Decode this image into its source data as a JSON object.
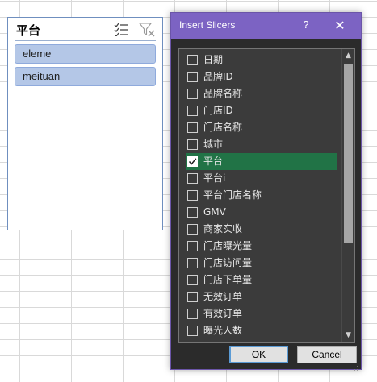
{
  "slicer": {
    "title": "平台",
    "multi_select_icon": "multi-select-icon",
    "clear_filter_icon": "clear-filter-icon",
    "items": [
      {
        "label": "eleme",
        "selected": true
      },
      {
        "label": "meituan",
        "selected": true
      }
    ]
  },
  "dialog": {
    "title": "Insert Slicers",
    "help_label": "?",
    "close_label": "✕",
    "fields": [
      {
        "label": "日期",
        "checked": false
      },
      {
        "label": "品牌ID",
        "checked": false
      },
      {
        "label": "品牌名称",
        "checked": false
      },
      {
        "label": "门店ID",
        "checked": false
      },
      {
        "label": "门店名称",
        "checked": false
      },
      {
        "label": "城市",
        "checked": false
      },
      {
        "label": "平台",
        "checked": true
      },
      {
        "label": "平台i",
        "checked": false
      },
      {
        "label": "平台门店名称",
        "checked": false
      },
      {
        "label": "GMV",
        "checked": false
      },
      {
        "label": "商家实收",
        "checked": false
      },
      {
        "label": "门店曝光量",
        "checked": false
      },
      {
        "label": "门店访问量",
        "checked": false
      },
      {
        "label": "门店下单量",
        "checked": false
      },
      {
        "label": "无效订单",
        "checked": false
      },
      {
        "label": "有效订单",
        "checked": false
      },
      {
        "label": "曝光人数",
        "checked": false
      }
    ],
    "ok_label": "OK",
    "cancel_label": "Cancel"
  },
  "colors": {
    "dialog_titlebar": "#7c63c3",
    "selected_row": "#217346",
    "slicer_item": "#b4c7e7"
  }
}
